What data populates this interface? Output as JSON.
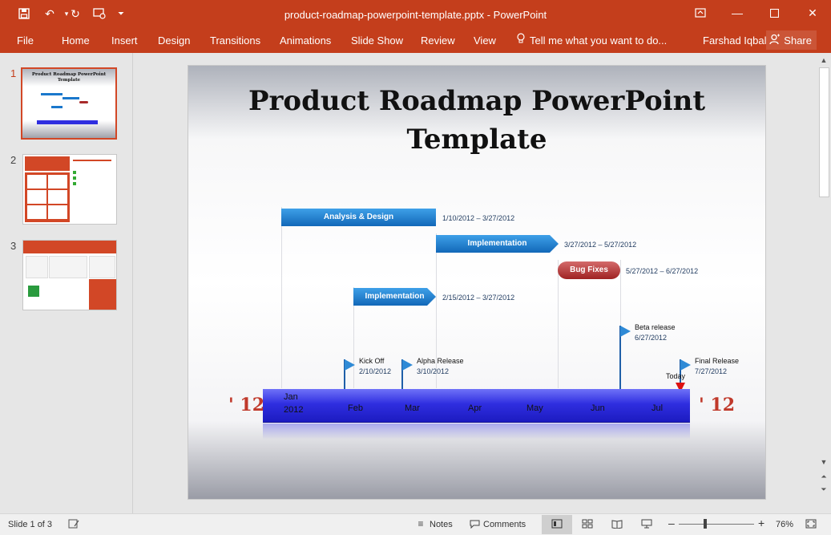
{
  "window": {
    "title": "product-roadmap-powerpoint-template.pptx - PowerPoint"
  },
  "ribbon": {
    "tabs": [
      "File",
      "Home",
      "Insert",
      "Design",
      "Transitions",
      "Animations",
      "Slide Show",
      "Review",
      "View"
    ],
    "tell_me": "Tell me what you want to do...",
    "user": "Farshad Iqbal",
    "share": "Share"
  },
  "thumbnails": {
    "numbers": [
      "1",
      "2",
      "3"
    ],
    "t1_title": "Product Roadmap PowerPoint Template"
  },
  "slide": {
    "title": "Product Roadmap PowerPoint Template",
    "tasks": [
      {
        "label": "Analysis & Design",
        "dates": "1/10/2012  –  3/27/2012"
      },
      {
        "label": "Implementation",
        "dates": "3/27/2012  –  5/27/2012"
      },
      {
        "label": "Bug Fixes",
        "dates": "5/27/2012  –  6/27/2012"
      },
      {
        "label": "Implementation",
        "dates": "2/15/2012  –  3/27/2012"
      }
    ],
    "milestones": [
      {
        "label": "Kick Off",
        "date": "2/10/2012"
      },
      {
        "label": "Alpha Release",
        "date": "3/10/2012"
      },
      {
        "label": "Beta release",
        "date": "6/27/2012"
      },
      {
        "label": "Final Release",
        "date": "7/27/2012"
      }
    ],
    "months": [
      "Jan",
      "Feb",
      "Mar",
      "Apr",
      "May",
      "Jun",
      "Jul"
    ],
    "first_year": "2012",
    "year_left": "' 12",
    "year_right": "' 12",
    "today": "Today"
  },
  "status": {
    "slide_of": "Slide 1 of 3",
    "notes": "Notes",
    "comments": "Comments",
    "zoom": "76%"
  },
  "colors": {
    "accent": "#c43e1c",
    "task_blue": "#1a78cc",
    "bug_red": "#a82a2a",
    "timeline": "#2f2ee0",
    "year_red": "#c0392b"
  }
}
